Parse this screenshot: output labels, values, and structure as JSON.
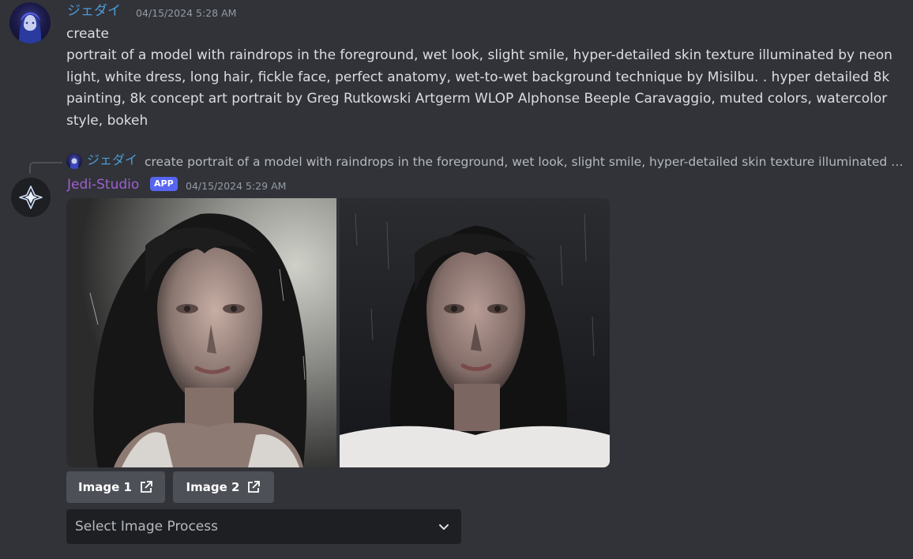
{
  "message1": {
    "username": "ジェダイ",
    "timestamp": "04/15/2024 5:28 AM",
    "command": "create",
    "prompt": "portrait of a model with raindrops in the foreground, wet look, slight smile, hyper-detailed skin texture illuminated by neon light, white dress, long hair, fickle face, perfect anatomy, wet-to-wet background technique by Misilbu. . hyper detailed 8k painting, 8k concept art portrait by Greg Rutkowski Artgerm WLOP Alphonse Beeple Caravaggio, muted colors, watercolor style, bokeh"
  },
  "reply": {
    "username": "ジェダイ",
    "text": "create portrait of a model with raindrops in the foreground, wet look, slight smile, hyper-detailed skin texture illuminated by neon light, white dress"
  },
  "message2": {
    "username": "Jedi-Studio",
    "badge": "APP",
    "timestamp": "04/15/2024 5:29 AM",
    "images": [
      {
        "icon": "portrait-image-1"
      },
      {
        "icon": "portrait-image-2"
      }
    ],
    "buttons": [
      {
        "label": "Image 1",
        "icon": "external-link-icon"
      },
      {
        "label": "Image 2",
        "icon": "external-link-icon"
      }
    ],
    "select": {
      "placeholder": "Select Image Process",
      "icon": "chevron-down-icon"
    }
  },
  "colors": {
    "background": "#313338",
    "username_user": "#4e9bd9",
    "username_bot": "#a05fd0",
    "badge": "#5865f2",
    "button": "#4e5058",
    "select": "#1e1f22"
  }
}
